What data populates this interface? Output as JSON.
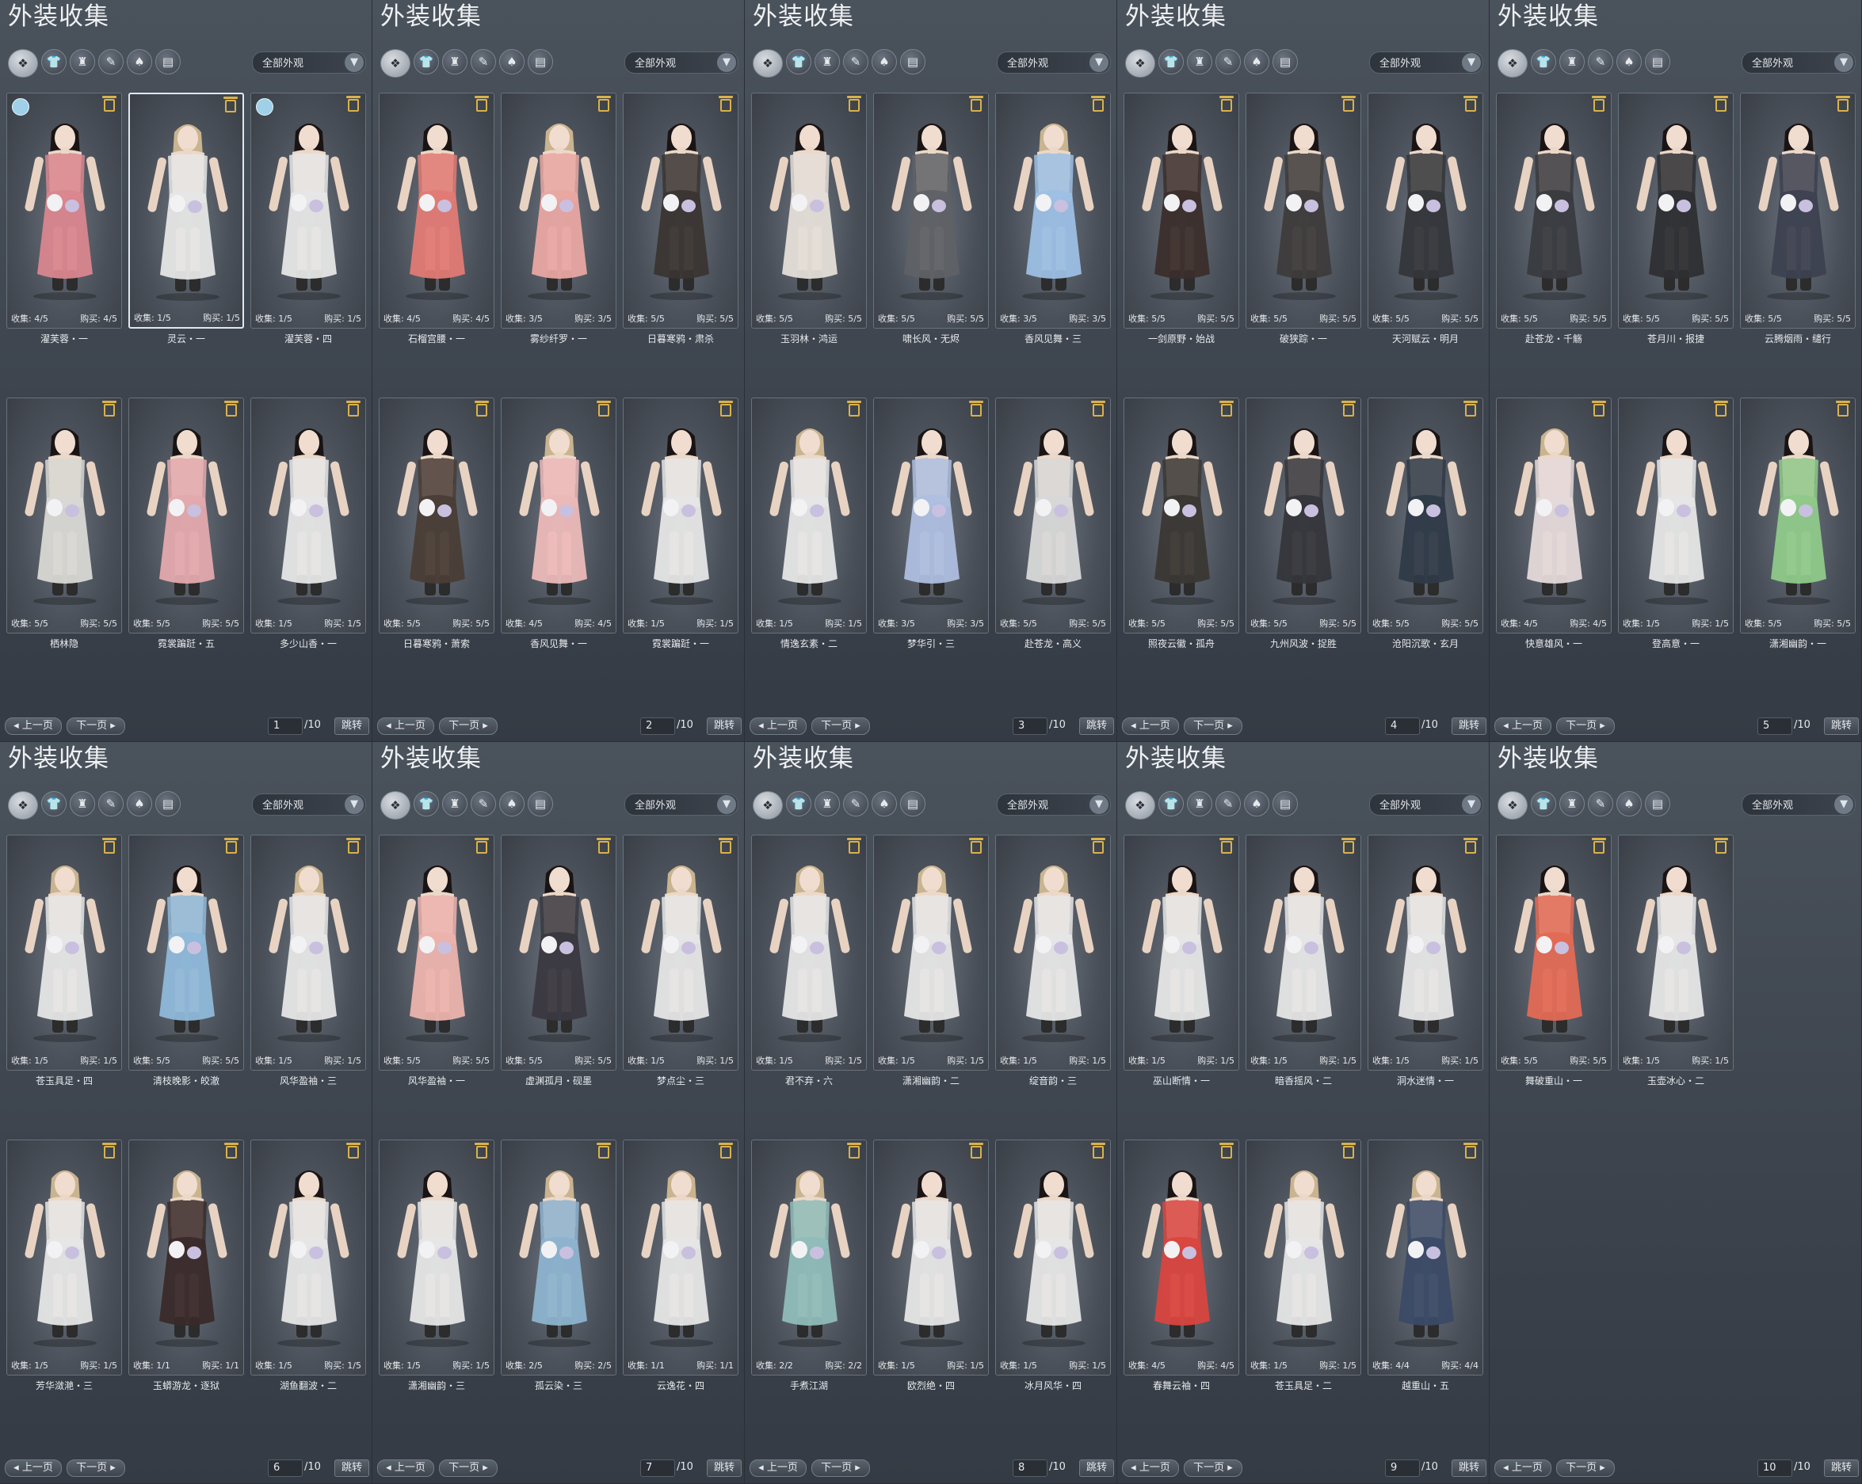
{
  "title": "外装收集",
  "filter": "全部外观",
  "pagination": {
    "prev": "上一页",
    "next": "下一页",
    "total": "/10",
    "jump": "跳转"
  },
  "stat_labels": {
    "collect": "收集:",
    "buy": "购买:"
  },
  "tab_icons": [
    "all-outfits-icon",
    "top-garment-icon",
    "robe-icon",
    "feather-icon",
    "headwear-icon",
    "scroll-icon"
  ],
  "colors": {
    "accent_trash": "#d9b24a",
    "text": "#e8eaed",
    "panel": "#444b55"
  },
  "pages": [
    {
      "page": "1",
      "items": [
        {
          "name": "濯芙蓉・一",
          "collect": "4/5",
          "buy": "4/5",
          "outfit": "#d9868e",
          "hair": "#1a1414",
          "badge": true
        },
        {
          "name": "灵云・一",
          "collect": "1/5",
          "buy": "1/5",
          "outfit": "#e6e6e6",
          "hair": "#c9b48f",
          "selected": true
        },
        {
          "name": "濯芙蓉・四",
          "collect": "1/5",
          "buy": "1/5",
          "outfit": "#e6e6e6",
          "hair": "#1a1414",
          "badge": true
        },
        {
          "name": "栖林隐",
          "collect": "5/5",
          "buy": "5/5",
          "outfit": "#d8d8d4",
          "hair": "#1a1414"
        },
        {
          "name": "霓裳蹁跹・五",
          "collect": "5/5",
          "buy": "5/5",
          "outfit": "#e3a9ad",
          "hair": "#1a1414"
        },
        {
          "name": "多少山香・一",
          "collect": "1/5",
          "buy": "1/5",
          "outfit": "#e6e6e6",
          "hair": "#1a1414"
        }
      ]
    },
    {
      "page": "2",
      "items": [
        {
          "name": "石榴宫腰・一",
          "collect": "4/5",
          "buy": "4/5",
          "outfit": "#e27a74",
          "hair": "#1a1414"
        },
        {
          "name": "雾纱纤罗・一",
          "collect": "3/5",
          "buy": "3/5",
          "outfit": "#e9a7a2",
          "hair": "#c9b48f"
        },
        {
          "name": "日暮寒鸦・肃杀",
          "collect": "5/5",
          "buy": "5/5",
          "outfit": "#3a3532",
          "hair": "#1a1414"
        },
        {
          "name": "日暮寒鸦・萧索",
          "collect": "5/5",
          "buy": "5/5",
          "outfit": "#4a3d36",
          "hair": "#1a1414"
        },
        {
          "name": "香风见舞・一",
          "collect": "4/5",
          "buy": "4/5",
          "outfit": "#ecb9b9",
          "hair": "#c9b48f"
        },
        {
          "name": "霓裳蹁跹・一",
          "collect": "1/5",
          "buy": "1/5",
          "outfit": "#e6e6e6",
          "hair": "#1a1414"
        }
      ]
    },
    {
      "page": "3",
      "items": [
        {
          "name": "玉羽林・鸿运",
          "collect": "5/5",
          "buy": "5/5",
          "outfit": "#e5ded8",
          "hair": "#1a1414"
        },
        {
          "name": "啸长风・无烬",
          "collect": "5/5",
          "buy": "5/5",
          "outfit": "#5f6166",
          "hair": "#1a1414"
        },
        {
          "name": "香风见舞・三",
          "collect": "3/5",
          "buy": "3/5",
          "outfit": "#9cbfe4",
          "hair": "#c9b48f"
        },
        {
          "name": "情逸玄素・二",
          "collect": "1/5",
          "buy": "1/5",
          "outfit": "#e6e6e6",
          "hair": "#c9b48f"
        },
        {
          "name": "梦华引・三",
          "collect": "3/5",
          "buy": "3/5",
          "outfit": "#aebedf",
          "hair": "#1a1414"
        },
        {
          "name": "赴苍龙・高义",
          "collect": "5/5",
          "buy": "5/5",
          "outfit": "#d8d8d8",
          "hair": "#1a1414"
        }
      ]
    },
    {
      "page": "4",
      "items": [
        {
          "name": "一剑原野・始战",
          "collect": "5/5",
          "buy": "5/5",
          "outfit": "#3b2e2c",
          "hair": "#1a1414"
        },
        {
          "name": "破狭踪・一",
          "collect": "5/5",
          "buy": "5/5",
          "outfit": "#3e3b3b",
          "hair": "#1a1414"
        },
        {
          "name": "天河赋云・明月",
          "collect": "5/5",
          "buy": "5/5",
          "outfit": "#34363a",
          "hair": "#1a1414"
        },
        {
          "name": "照夜云徽・孤舟",
          "collect": "5/5",
          "buy": "5/5",
          "outfit": "#3a3734",
          "hair": "#1a1414"
        },
        {
          "name": "九州风波・捉胜",
          "collect": "5/5",
          "buy": "5/5",
          "outfit": "#35363b",
          "hair": "#1a1414"
        },
        {
          "name": "沧阳沉歌・玄月",
          "collect": "5/5",
          "buy": "5/5",
          "outfit": "#2f3a48",
          "hair": "#1a1414"
        }
      ]
    },
    {
      "page": "5",
      "items": [
        {
          "name": "赴苍龙・千觞",
          "collect": "5/5",
          "buy": "5/5",
          "outfit": "#393b40",
          "hair": "#1a1414"
        },
        {
          "name": "苍月川・报捷",
          "collect": "5/5",
          "buy": "5/5",
          "outfit": "#2e2f33",
          "hair": "#1a1414"
        },
        {
          "name": "云腾烟雨・缱行",
          "collect": "5/5",
          "buy": "5/5",
          "outfit": "#3d4150",
          "hair": "#1a1414"
        },
        {
          "name": "快意雄风・一",
          "collect": "4/5",
          "buy": "4/5",
          "outfit": "#e5d9d9",
          "hair": "#c9b48f"
        },
        {
          "name": "登高意・一",
          "collect": "1/5",
          "buy": "1/5",
          "outfit": "#e6e6e6",
          "hair": "#1a1414"
        },
        {
          "name": "潇湘幽韵・一",
          "collect": "5/5",
          "buy": "5/5",
          "outfit": "#8fc98a",
          "hair": "#1a1414"
        }
      ]
    },
    {
      "page": "6",
      "items": [
        {
          "name": "苍玉具足・四",
          "collect": "1/5",
          "buy": "1/5",
          "outfit": "#e6e6e6",
          "hair": "#c9b48f"
        },
        {
          "name": "清枝晚影・皎澈",
          "collect": "5/5",
          "buy": "5/5",
          "outfit": "#8fb8d9",
          "hair": "#1a1414"
        },
        {
          "name": "风华盈袖・三",
          "collect": "1/5",
          "buy": "1/5",
          "outfit": "#e6e6e6",
          "hair": "#c9b48f"
        },
        {
          "name": "芳华潋滟・三",
          "collect": "1/5",
          "buy": "1/5",
          "outfit": "#e6e6e6",
          "hair": "#c9b48f"
        },
        {
          "name": "玉蟒游龙・逐狱",
          "collect": "1/1",
          "buy": "1/1",
          "outfit": "#3a2a2a",
          "hair": "#c9b48f"
        },
        {
          "name": "湖鱼翻波・二",
          "collect": "1/5",
          "buy": "1/5",
          "outfit": "#e6e6e6",
          "hair": "#1a1414"
        }
      ]
    },
    {
      "page": "7",
      "items": [
        {
          "name": "风华盈袖・一",
          "collect": "5/5",
          "buy": "5/5",
          "outfit": "#ecb3ad",
          "hair": "#1a1414"
        },
        {
          "name": "虚渊孤月・砚墨",
          "collect": "5/5",
          "buy": "5/5",
          "outfit": "#3a3840",
          "hair": "#1a1414"
        },
        {
          "name": "梦点尘・三",
          "collect": "1/5",
          "buy": "1/5",
          "outfit": "#e6e6e6",
          "hair": "#c9b48f"
        },
        {
          "name": "潇湘幽韵・三",
          "collect": "1/5",
          "buy": "1/5",
          "outfit": "#e6e6e6",
          "hair": "#1a1414"
        },
        {
          "name": "孤云染・三",
          "collect": "2/5",
          "buy": "2/5",
          "outfit": "#8db3cf",
          "hair": "#c9b48f"
        },
        {
          "name": "云逸花・四",
          "collect": "1/1",
          "buy": "1/1",
          "outfit": "#e6e6e6",
          "hair": "#c9b48f"
        }
      ]
    },
    {
      "page": "8",
      "items": [
        {
          "name": "君不弃・六",
          "collect": "1/5",
          "buy": "1/5",
          "outfit": "#e6e6e6",
          "hair": "#c9b48f"
        },
        {
          "name": "潇湘幽韵・二",
          "collect": "1/5",
          "buy": "1/5",
          "outfit": "#e6e6e6",
          "hair": "#c9b48f"
        },
        {
          "name": "绽音韵・三",
          "collect": "1/5",
          "buy": "1/5",
          "outfit": "#e6e6e6",
          "hair": "#c9b48f"
        },
        {
          "name": "手煮江湖",
          "collect": "2/2",
          "buy": "2/2",
          "outfit": "#8fbcb8",
          "hair": "#c9b48f"
        },
        {
          "name": "欧烈绝・四",
          "collect": "1/5",
          "buy": "1/5",
          "outfit": "#e6e6e6",
          "hair": "#1a1414"
        },
        {
          "name": "冰月风华・四",
          "collect": "1/5",
          "buy": "1/5",
          "outfit": "#e6e6e6",
          "hair": "#1a1414"
        }
      ]
    },
    {
      "page": "9",
      "items": [
        {
          "name": "巫山断情・一",
          "collect": "1/5",
          "buy": "1/5",
          "outfit": "#e6e6e6",
          "hair": "#1a1414"
        },
        {
          "name": "暗香摇风・二",
          "collect": "1/5",
          "buy": "1/5",
          "outfit": "#e6e6e6",
          "hair": "#1a1414"
        },
        {
          "name": "洞水迷情・一",
          "collect": "1/5",
          "buy": "1/5",
          "outfit": "#e6e6e6",
          "hair": "#1a1414"
        },
        {
          "name": "春舞云袖・四",
          "collect": "4/5",
          "buy": "4/5",
          "outfit": "#d9453f",
          "hair": "#1a1414"
        },
        {
          "name": "苍玉具足・二",
          "collect": "1/5",
          "buy": "1/5",
          "outfit": "#e6e6e6",
          "hair": "#c9b48f"
        },
        {
          "name": "越重山・五",
          "collect": "4/4",
          "buy": "4/4",
          "outfit": "#3b4a66",
          "hair": "#c9b48f"
        }
      ]
    },
    {
      "page": "10",
      "items": [
        {
          "name": "舞破重山・一",
          "collect": "5/5",
          "buy": "5/5",
          "outfit": "#e26a55",
          "hair": "#1a1414"
        },
        {
          "name": "玉壶冰心・二",
          "collect": "1/5",
          "buy": "1/5",
          "outfit": "#e6e6e6",
          "hair": "#1a1414"
        }
      ]
    }
  ]
}
